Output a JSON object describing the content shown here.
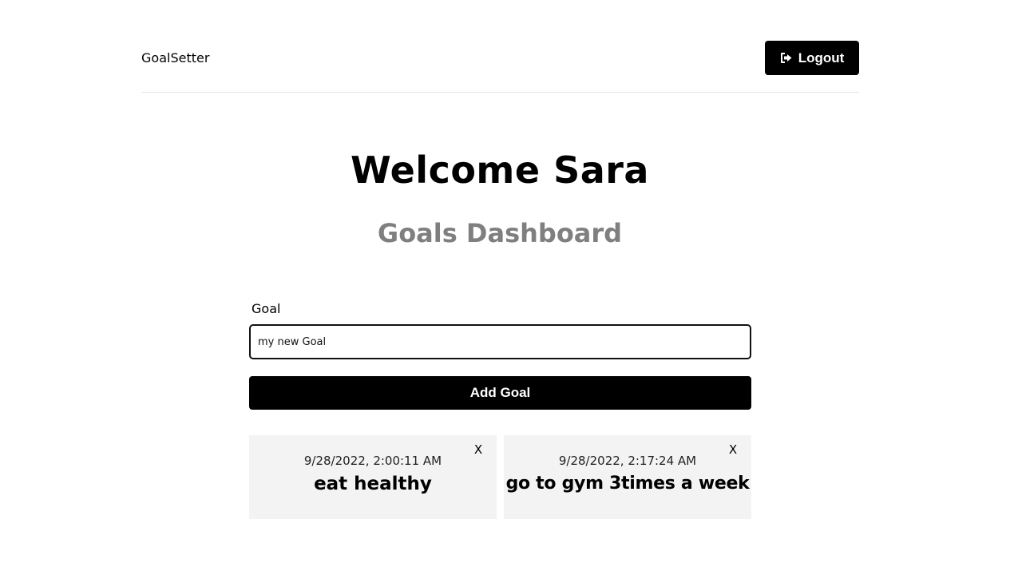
{
  "header": {
    "logo": "GoalSetter",
    "logout_label": "Logout",
    "logout_icon": "sign-out-icon"
  },
  "welcome": "Welcome Sara",
  "dashboard_title": "Goals Dashboard",
  "form": {
    "label": "Goal",
    "value": "my new Goal",
    "submit_label": "Add Goal"
  },
  "goals": [
    {
      "date": "9/28/2022, 2:00:11 AM",
      "text": "eat healthy",
      "close": "X"
    },
    {
      "date": "9/28/2022, 2:17:24 AM",
      "text": "go to gym 3times a week",
      "close": "X"
    }
  ]
}
